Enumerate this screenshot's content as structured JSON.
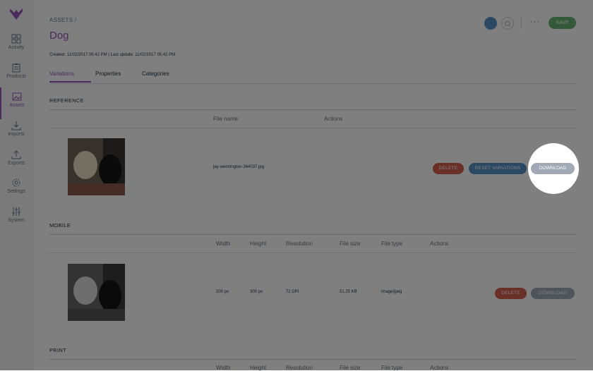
{
  "sidebar": {
    "items": [
      {
        "label": "Activity",
        "icon": "activity-icon"
      },
      {
        "label": "Products",
        "icon": "clipboard-icon"
      },
      {
        "label": "Assets",
        "icon": "image-icon"
      },
      {
        "label": "Imports",
        "icon": "download-icon"
      },
      {
        "label": "Exports",
        "icon": "upload-icon"
      },
      {
        "label": "Settings",
        "icon": "gear-icon"
      },
      {
        "label": "System",
        "icon": "sliders-icon"
      }
    ]
  },
  "header": {
    "breadcrumb": "ASSETS /",
    "title": "Dog",
    "meta": "Created: 11/02/2017 05:42 PM | Last update: 11/02/2017 05:42 PM",
    "more": "···",
    "save_label": "SAVE"
  },
  "tabs": [
    {
      "label": "Variations",
      "active": true
    },
    {
      "label": "Properties",
      "active": false
    },
    {
      "label": "Categories",
      "active": false
    }
  ],
  "reference": {
    "title": "REFERENCE",
    "columns": [
      "File name",
      "Actions"
    ],
    "file_name": "jay-wennington-364037.jpg",
    "actions": [
      "DELETE",
      "RESET VARIATIONS",
      "DOWNLOAD"
    ]
  },
  "mobile": {
    "title": "MOBILE",
    "columns": [
      "Width",
      "Height",
      "Resolution",
      "File size",
      "File type",
      "Actions"
    ],
    "row": {
      "width": "200 px",
      "height": "300 px",
      "resolution": "72 DPI",
      "file_size": "51.25 KB",
      "file_type": "image/jpeg"
    },
    "actions": [
      "DELETE",
      "DOWNLOAD"
    ]
  },
  "print": {
    "title": "PRINT",
    "columns": [
      "Width",
      "Height",
      "Resolution",
      "File size",
      "File type",
      "Actions"
    ]
  },
  "colors": {
    "accent": "#9452ba",
    "save": "#67b373",
    "delete": "#d4604d",
    "reset": "#5992c7",
    "download": "#a1a9b7"
  }
}
